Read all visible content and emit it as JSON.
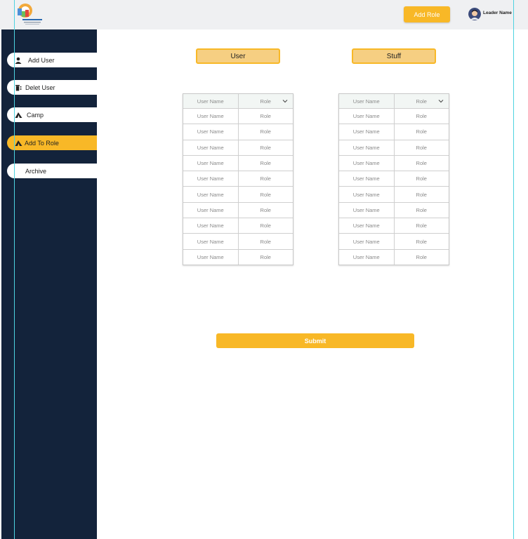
{
  "header": {
    "add_role_label": "Add Role",
    "leader_name": "Leader Name"
  },
  "sidebar": {
    "items": [
      {
        "label": "Add User",
        "icon": "user-icon",
        "active": false
      },
      {
        "label": "Delet User",
        "icon": "trash-icon",
        "active": false
      },
      {
        "label": "Camp",
        "icon": "tent-icon",
        "active": false
      },
      {
        "label": "Add To Role",
        "icon": "tent-icon",
        "active": true
      },
      {
        "label": "Archive",
        "icon": "",
        "active": false
      }
    ]
  },
  "tabs": {
    "user_label": "User",
    "stuff_label": "Stuff"
  },
  "tables": {
    "header_name": "User Name",
    "header_role": "Role",
    "row_name": "User Name",
    "row_role": "Role",
    "row_count": 10
  },
  "submit_label": "Submit",
  "colors": {
    "accent": "#f8b827",
    "sidebar": "#13233b",
    "topbar": "#eff0f2"
  }
}
